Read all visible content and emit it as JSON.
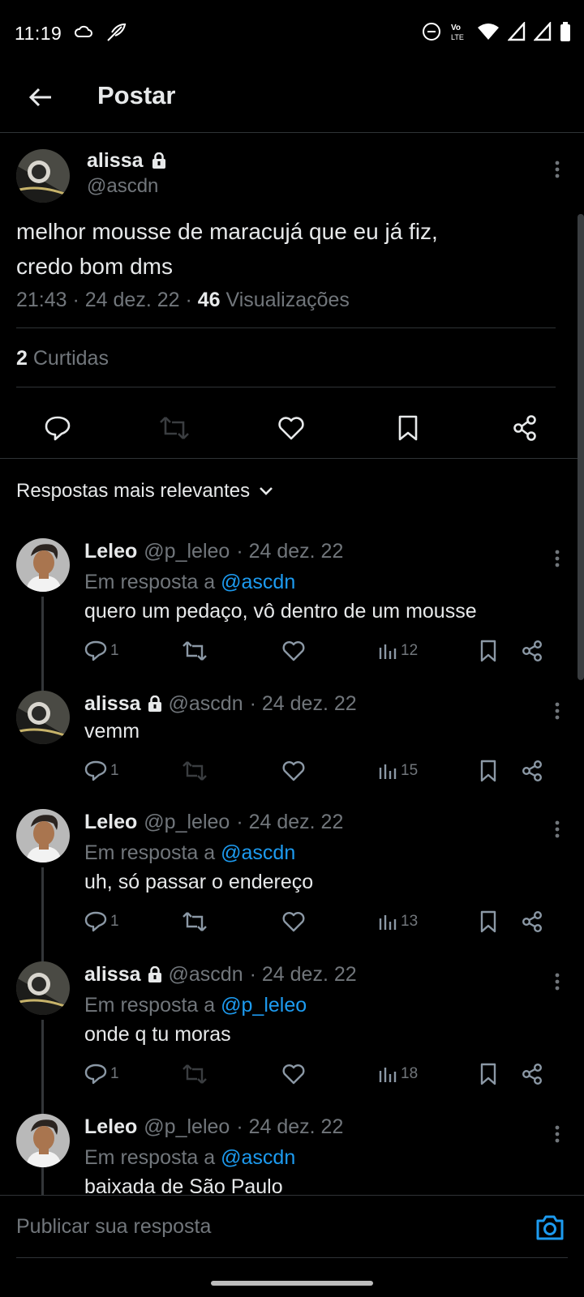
{
  "status_bar": {
    "time": "11:19",
    "volte": "Vo· LTE"
  },
  "header": {
    "title": "Postar"
  },
  "post": {
    "name": "alissa",
    "handle": "@ascdn",
    "text_line1": "melhor mousse de maracujá que eu já fiz,",
    "text_line2": "credo bom dms",
    "time": "21:43 · 24 dez. 22 · ",
    "views_count": "46",
    "views_label": " Visualizações",
    "likes_count": "2",
    "likes_label": " Curtidas"
  },
  "sort": {
    "label": "Respostas mais relevantes"
  },
  "replies": [
    {
      "name": "Leleo",
      "handle": "@p_leleo",
      "date": "· 24 dez. 22",
      "reply_prefix": "Em resposta a ",
      "reply_to": "@ascdn",
      "text": "quero um pedaço, vô dentro de um mousse",
      "replies_count": "1",
      "views_count": "12",
      "avatar": "leleo"
    },
    {
      "name": "alissa",
      "handle": "@ascdn",
      "date": "· 24 dez. 22",
      "reply_prefix": "",
      "reply_to": "",
      "text": "vemm",
      "replies_count": "1",
      "views_count": "15",
      "avatar": "alissa"
    },
    {
      "name": "Leleo",
      "handle": "@p_leleo",
      "date": "· 24 dez. 22",
      "reply_prefix": "Em resposta a ",
      "reply_to": "@ascdn",
      "text": "uh, só passar o endereço",
      "replies_count": "1",
      "views_count": "13",
      "avatar": "leleo"
    },
    {
      "name": "alissa",
      "handle": "@ascdn",
      "date": "· 24 dez. 22",
      "reply_prefix": "Em resposta a ",
      "reply_to": "@p_leleo",
      "text": "onde q tu moras",
      "replies_count": "1",
      "views_count": "18",
      "avatar": "alissa"
    },
    {
      "name": "Leleo",
      "handle": "@p_leleo",
      "date": "· 24 dez. 22",
      "reply_prefix": "Em resposta a ",
      "reply_to": "@ascdn",
      "text": "baixada de São Paulo",
      "replies_count": "",
      "views_count": "",
      "avatar": "leleo"
    }
  ],
  "composer": {
    "placeholder": "Publicar sua resposta"
  },
  "colors": {
    "background": "#000000",
    "text": "#e7e9ea",
    "muted": "#71767b",
    "link": "#1d9bf0",
    "divider": "#2f3336"
  }
}
